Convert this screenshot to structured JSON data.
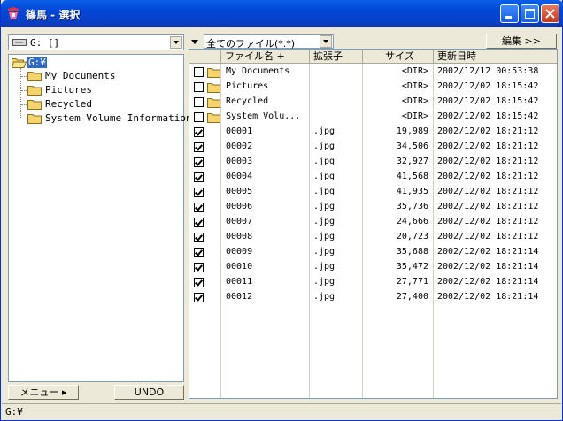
{
  "window": {
    "title": "篠馬 - 選択",
    "buttons": {
      "minimize": "minimize",
      "maximize": "maximize",
      "close": "close"
    }
  },
  "left_panel": {
    "drive_combo_value": "G: []",
    "tree": {
      "root_label": "G:¥",
      "children": [
        "My Documents",
        "Pictures",
        "Recycled",
        "System Volume Information"
      ]
    },
    "menu_button": "メニュー ▸",
    "undo_button": "UNDO"
  },
  "right_panel": {
    "filter_combo_value": "全てのファイル(*.*)",
    "edit_button": "編集 >>",
    "columns": [
      "ファイル名 +",
      "拡張子",
      "サイズ",
      "更新日時"
    ],
    "rows": [
      {
        "checked": false,
        "folder": true,
        "name": "My Documents",
        "ext": "",
        "size": "<DIR>",
        "date": "2002/12/12 00:53:38"
      },
      {
        "checked": false,
        "folder": true,
        "name": "Pictures",
        "ext": "",
        "size": "<DIR>",
        "date": "2002/12/02 18:15:42"
      },
      {
        "checked": false,
        "folder": true,
        "name": "Recycled",
        "ext": "",
        "size": "<DIR>",
        "date": "2002/12/02 18:15:42"
      },
      {
        "checked": false,
        "folder": true,
        "name": "System Volu...",
        "ext": "",
        "size": "<DIR>",
        "date": "2002/12/02 18:15:42"
      },
      {
        "checked": true,
        "folder": false,
        "name": "00001",
        "ext": ".jpg",
        "size": "19,989",
        "date": "2002/12/02 18:21:12"
      },
      {
        "checked": true,
        "folder": false,
        "name": "00002",
        "ext": ".jpg",
        "size": "34,506",
        "date": "2002/12/02 18:21:12"
      },
      {
        "checked": true,
        "folder": false,
        "name": "00003",
        "ext": ".jpg",
        "size": "32,927",
        "date": "2002/12/02 18:21:12"
      },
      {
        "checked": true,
        "folder": false,
        "name": "00004",
        "ext": ".jpg",
        "size": "41,568",
        "date": "2002/12/02 18:21:12"
      },
      {
        "checked": true,
        "folder": false,
        "name": "00005",
        "ext": ".jpg",
        "size": "41,935",
        "date": "2002/12/02 18:21:12"
      },
      {
        "checked": true,
        "folder": false,
        "name": "00006",
        "ext": ".jpg",
        "size": "35,736",
        "date": "2002/12/02 18:21:12"
      },
      {
        "checked": true,
        "folder": false,
        "name": "00007",
        "ext": ".jpg",
        "size": "24,666",
        "date": "2002/12/02 18:21:12"
      },
      {
        "checked": true,
        "folder": false,
        "name": "00008",
        "ext": ".jpg",
        "size": "20,723",
        "date": "2002/12/02 18:21:12"
      },
      {
        "checked": true,
        "folder": false,
        "name": "00009",
        "ext": ".jpg",
        "size": "35,688",
        "date": "2002/12/02 18:21:14"
      },
      {
        "checked": true,
        "folder": false,
        "name": "00010",
        "ext": ".jpg",
        "size": "35,472",
        "date": "2002/12/02 18:21:14"
      },
      {
        "checked": true,
        "folder": false,
        "name": "00011",
        "ext": ".jpg",
        "size": "27,771",
        "date": "2002/12/02 18:21:14"
      },
      {
        "checked": true,
        "folder": false,
        "name": "00012",
        "ext": ".jpg",
        "size": "27,400",
        "date": "2002/12/02 18:21:14"
      }
    ]
  },
  "status_bar": {
    "text": "G:¥"
  },
  "icons": {
    "app": "app-logo-icon",
    "drive": "drive-icon",
    "folder": "folder-icon",
    "dropdown": "chevron-down-icon",
    "filter_arrow": "filter-arrow-icon"
  },
  "colors": {
    "titlebar": "#0054e3",
    "folder": "#f5d56b",
    "selection": "#316ac5"
  }
}
